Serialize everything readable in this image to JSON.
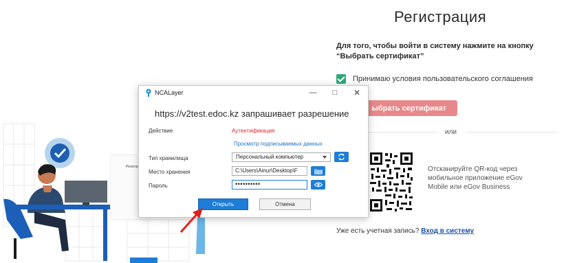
{
  "page": {
    "title": "Регистрация",
    "instruction": "Для того, чтобы войти в систему нажмите на кнопку “Выбрать сертификат”",
    "agree_label": "Принимаю условия пользовательского соглашения",
    "choose_cert_label": "ыбрать сертификат",
    "or_label": "или",
    "qr_text": "Отсканируйте QR-код через мобильное приложение eGov Mobile или eGov Business",
    "have_account_label": "Уже есть учетная запись?",
    "login_link_label": "Вход в систему",
    "doc_sheet_title": "Регистр"
  },
  "dialog": {
    "window_title": "NCALayer",
    "heading": "https://v2test.edoc.kz запрашивает разрешение",
    "action_label": "Действие",
    "action_value": "Аутентификация",
    "view_data_link": "Просмотр подписываемых данных",
    "storage_type_label": "Тип хранилища",
    "storage_type_value": "Персональный компьютер",
    "storage_place_label": "Место хранения",
    "storage_path_value": "C:\\Users\\Ainur\\Desktop\\F",
    "password_label": "Пароль",
    "password_value": "••••••••••",
    "open_button": "Открыть",
    "cancel_button": "Отмена"
  },
  "colors": {
    "accent_blue": "#1e7dd6",
    "checkbox_green": "#2fa877",
    "cert_button_pink": "#e8888a",
    "action_red": "#d8262f",
    "pointer_red": "#e02020"
  },
  "icons": [
    "ncalayer-logo-icon",
    "minimize-icon",
    "maximize-icon",
    "close-icon",
    "dropdown-chevron-icon",
    "refresh-icon",
    "folder-icon",
    "eye-icon",
    "checkmark-icon",
    "red-arrow-pointer-icon",
    "qr-code-icon"
  ]
}
